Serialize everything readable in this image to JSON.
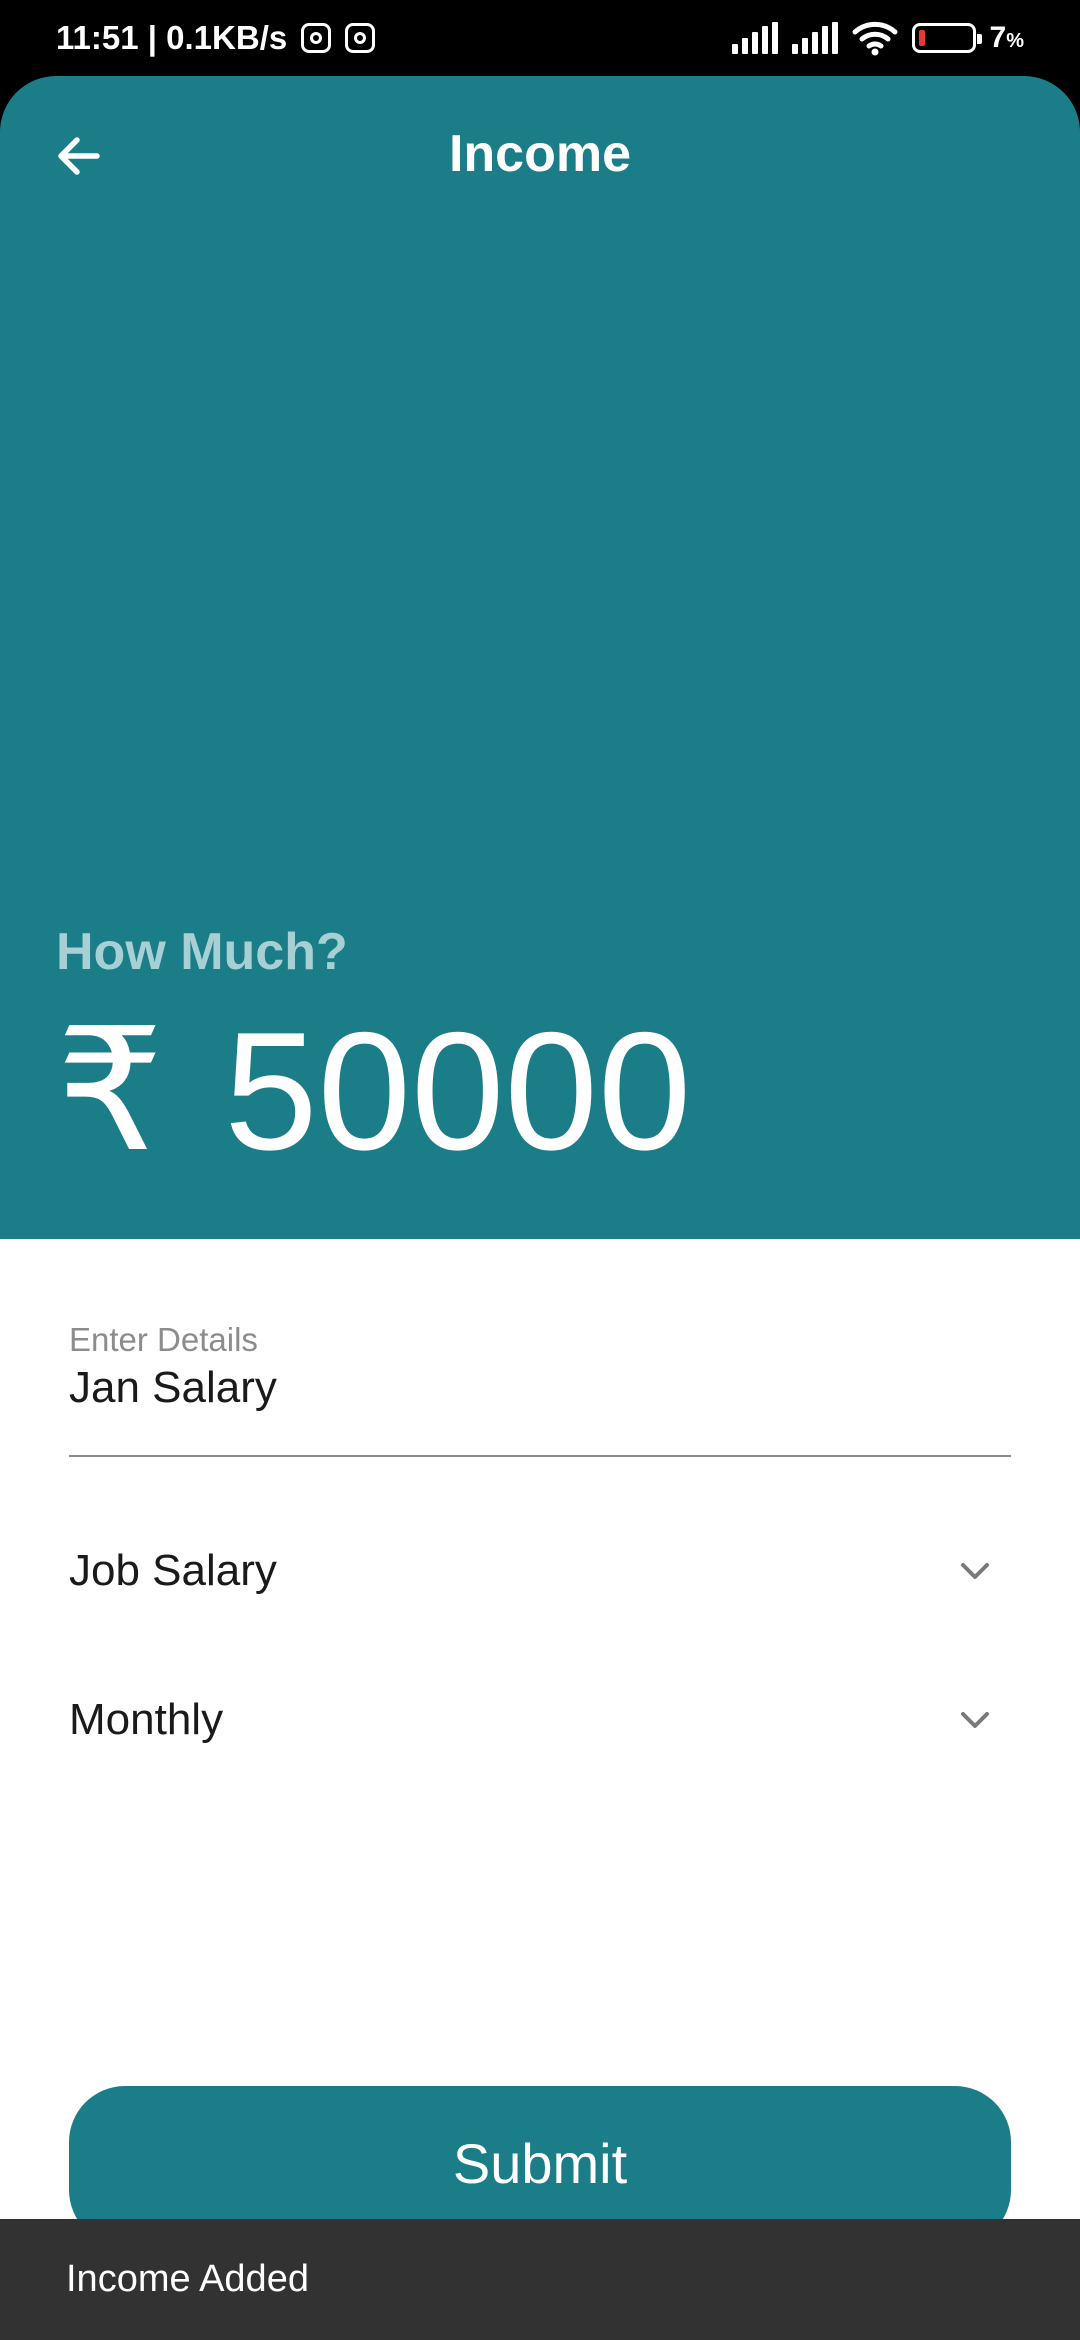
{
  "status_bar": {
    "time_speed": "11:51 | 0.1KB/s",
    "battery": "7",
    "battery_unit": "%"
  },
  "header": {
    "title": "Income",
    "back_icon": "arrow-left-icon"
  },
  "amount": {
    "prompt": "How Much?",
    "currency_symbol": "₹",
    "value": "50000"
  },
  "details_field": {
    "label": "Enter Details",
    "value": "Jan Salary"
  },
  "category_dropdown": {
    "selected": "Job Salary",
    "icon": "chevron-down-icon"
  },
  "frequency_dropdown": {
    "selected": "Monthly",
    "icon": "chevron-down-icon"
  },
  "submit": {
    "label": "Submit"
  },
  "snackbar": {
    "message": "Income Added"
  },
  "colors": {
    "primary": "#1a7d88",
    "prompt_text": "#a6d0d4",
    "snackbar_bg": "#323232"
  }
}
